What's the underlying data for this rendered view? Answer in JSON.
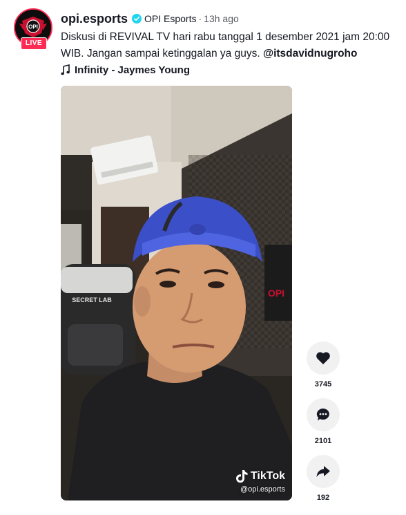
{
  "post": {
    "username": "opi.esports",
    "nickname": "OPI Esports",
    "separator": "·",
    "time_ago": "13h ago",
    "live_badge": "LIVE",
    "avatar_text": "OPI",
    "caption_text": "Diskusi di REVIVAL TV hari rabu tanggal 1 desember 2021 jam 20:00 WIB. Jangan sampai ketinggalan ya guys. ",
    "mention": "@itsdavidnugroho",
    "music_title": "Infinity - Jaymes Young"
  },
  "video": {
    "watermark_logo": "TikTok",
    "watermark_handle": "@opi.esports",
    "chair_text": "SECRET LAB",
    "poster_text": "OPI"
  },
  "actions": {
    "likes": "3745",
    "comments": "2101",
    "shares": "192"
  },
  "colors": {
    "live_red": "#fe2c55",
    "verified_blue": "#20d5ec",
    "action_bg": "#f1f1f2"
  },
  "icons": {
    "verified": "verified-check-icon",
    "music": "music-note-icon",
    "like": "heart-icon",
    "comment": "comment-bubble-icon",
    "share": "share-arrow-icon"
  }
}
